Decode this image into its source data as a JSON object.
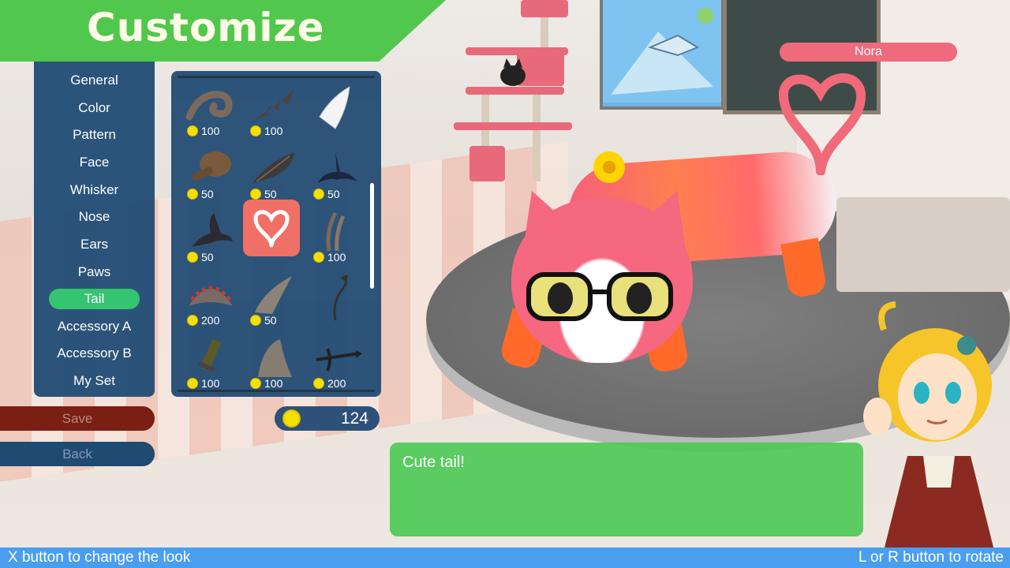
{
  "title": "Customize",
  "menu": {
    "items": [
      "General",
      "Color",
      "Pattern",
      "Face",
      "Whisker",
      "Nose",
      "Ears",
      "Paws",
      "Tail",
      "Accessory A",
      "Accessory B",
      "My Set"
    ],
    "active": "Tail"
  },
  "items_grid": {
    "rows": [
      [
        {
          "icon": "curl-tail-icon",
          "price": "100"
        },
        {
          "icon": "spiky-tail-icon",
          "price": "100"
        },
        {
          "icon": "white-fin-tail-icon",
          "price": ""
        }
      ],
      [
        {
          "icon": "drumstick-tail-icon",
          "price": "50"
        },
        {
          "icon": "leaf-tail-icon",
          "price": "50"
        },
        {
          "icon": "whale-tail-icon",
          "price": "50"
        }
      ],
      [
        {
          "icon": "fish-tail-icon",
          "price": "50"
        },
        {
          "icon": "heart-tail-icon",
          "price": "",
          "selected": true
        },
        {
          "icon": "double-strand-tail-icon",
          "price": "100"
        }
      ],
      [
        {
          "icon": "feather-fan-tail-icon",
          "price": "200"
        },
        {
          "icon": "horn-tail-icon",
          "price": "50"
        },
        {
          "icon": "devil-tail-icon",
          "price": ""
        }
      ],
      [
        {
          "icon": "sword-tail-icon",
          "price": "100"
        },
        {
          "icon": "shark-fin-tail-icon",
          "price": "100"
        },
        {
          "icon": "crossbow-tail-icon",
          "price": "200"
        }
      ]
    ]
  },
  "buttons": {
    "save": "Save",
    "back": "Back"
  },
  "coins": "124",
  "pet_name": "Nora",
  "dialogue": "Cute tail!",
  "hints": {
    "left": "X button to change the look",
    "right": "L or R button to rotate"
  },
  "colors": {
    "accent_green": "#52c74d",
    "panel_blue": "#254e75",
    "selected_tab": "#2ec46d",
    "selected_item": "#f07066",
    "hint_bar": "#4a9ef0",
    "name_tag": "#ef6a7c"
  }
}
